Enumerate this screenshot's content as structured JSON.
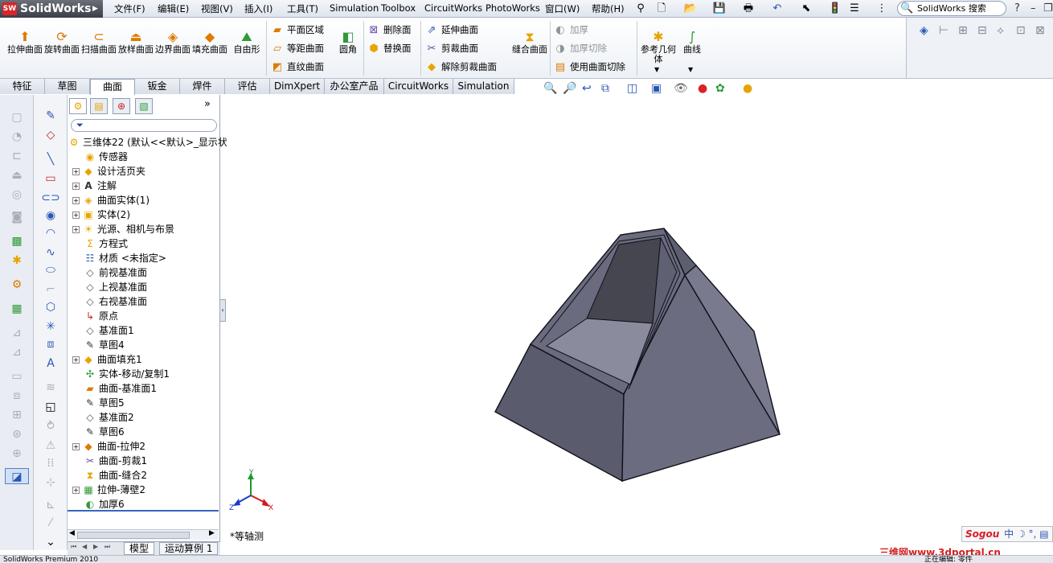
{
  "app": {
    "logo_badge": "SW",
    "logo_text": "SolidWorks"
  },
  "menu": {
    "items": [
      "文件(F)",
      "编辑(E)",
      "视图(V)",
      "插入(I)",
      "工具(T)",
      "Simulation",
      "Toolbox",
      "CircuitWorks",
      "PhotoWorks",
      "窗口(W)",
      "帮助(H)"
    ]
  },
  "search": {
    "placeholder": "SolidWorks 搜索"
  },
  "ribbon": {
    "large_buttons": [
      {
        "label": "拉伸曲面"
      },
      {
        "label": "旋转曲面"
      },
      {
        "label": "扫描曲面"
      },
      {
        "label": "放样曲面"
      },
      {
        "label": "边界曲面"
      },
      {
        "label": "填充曲面"
      },
      {
        "label": "自由形"
      }
    ],
    "col1": [
      "平面区域",
      "等距曲面",
      "直纹曲面"
    ],
    "round": "圆角",
    "col2": [
      "删除面",
      "替换面"
    ],
    "col3": [
      "延伸曲面",
      "剪裁曲面",
      "解除剪裁曲面"
    ],
    "knit": "缝合曲面",
    "col4": [
      "加厚",
      "加厚切除",
      "使用曲面切除"
    ],
    "ref_geom": "参考几何体",
    "curves": "曲线"
  },
  "tabs": [
    "特征",
    "草图",
    "曲面",
    "钣金",
    "焊件",
    "评估",
    "DimXpert",
    "办公室产品",
    "CircuitWorks",
    "Simulation"
  ],
  "active_tab": "曲面",
  "tree": {
    "root": "三维体22  (默认<<默认>_显示状",
    "nodes": [
      {
        "label": "传感器"
      },
      {
        "label": "设计活页夹"
      },
      {
        "label": "注解"
      },
      {
        "label": "曲面实体(1)"
      },
      {
        "label": "实体(2)"
      },
      {
        "label": "光源、相机与布景"
      },
      {
        "label": "方程式"
      },
      {
        "label": "材质 <未指定>"
      },
      {
        "label": "前视基准面"
      },
      {
        "label": "上视基准面"
      },
      {
        "label": "右视基准面"
      },
      {
        "label": "原点"
      },
      {
        "label": "基准面1"
      },
      {
        "label": "草图4"
      },
      {
        "label": "曲面填充1"
      },
      {
        "label": "实体-移动/复制1"
      },
      {
        "label": "曲面-基准面1"
      },
      {
        "label": "草图5"
      },
      {
        "label": "基准面2"
      },
      {
        "label": "草图6"
      },
      {
        "label": "曲面-拉伸2"
      },
      {
        "label": "曲面-剪裁1"
      },
      {
        "label": "曲面-缝合2"
      },
      {
        "label": "拉伸-薄壁2"
      },
      {
        "label": "加厚6"
      }
    ]
  },
  "bottom_tabs": [
    "模型",
    "运动算例 1"
  ],
  "view": {
    "orientation_label": "*等轴测"
  },
  "triad": {
    "x": "X",
    "y": "Y",
    "z": "Z"
  },
  "status": {
    "left": "SolidWorks Premium 2010",
    "right": "正在编辑: 零件"
  },
  "ime": {
    "brand": "Sogou",
    "mode": "中"
  },
  "watermark": "三维网www.3dportal.cn"
}
